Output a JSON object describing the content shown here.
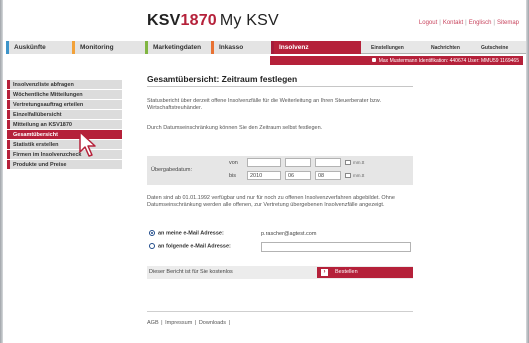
{
  "header": {
    "brand": "KSV",
    "year": "1870",
    "subtitle": "My KSV",
    "toplinks": [
      "Logout",
      "Kontakt",
      "Englisch",
      "Sitemap"
    ]
  },
  "nav": {
    "tabs": [
      "Auskünfte",
      "Monitoring",
      "Marketingdaten",
      "Inkasso",
      "Insolvenz"
    ],
    "subtabs": [
      "Einstellungen",
      "Nachrichten",
      "Gutscheine"
    ]
  },
  "userbar": {
    "text": "Max Mustermann Identifikation: 440674 User: MMU59 1169465"
  },
  "sidebar": {
    "items": [
      "Insolvenzliste abfragen",
      "Wöchentliche Mitteilungen",
      "Vertretungsauftrag erteilen",
      "Einzelfallübersicht",
      "Mitteilung an KSV1870",
      "Gesamtübersicht",
      "Statistik erstellen",
      "Firmen im Insolvenzcheck",
      "Produkte und Preise"
    ],
    "active_index": 5
  },
  "main": {
    "title": "Gesamtübersicht: Zeitraum festlegen",
    "intro": "Statusbericht über derzeit offene Insolvenzfälle für die Weiterleitung an Ihren Steuerberater bzw. Wirtschaftstreuhänder.",
    "hint": "Durch Datumseinschränkung können Sie den Zeitraum selbst festlegen.",
    "date": {
      "label": "Übergabedatum:",
      "from_label": "von",
      "to_label": "bis",
      "from": {
        "day": "",
        "month": "",
        "year": ""
      },
      "to": {
        "year": "2010",
        "month": "06",
        "day": "08"
      },
      "format": "mm.tt"
    },
    "notice": "Daten sind ab 01.01.1992 verfügbar und nur für noch zu offenen Insolvenzverfahren abgebildet. Ohne Datumseinschränkung werden alle offenen, zur Vertretung übergebenen Insolvenzfälle angezeigt.",
    "delivery": {
      "option1": "an meine e-Mail Adresse:",
      "option1_value": "p.rascher@agtest.com",
      "option2": "an folgende e-Mail Adresse:",
      "option2_value": ""
    },
    "cost": "Dieser Bericht ist für Sie kostenlos",
    "order_button": "Bestellen"
  },
  "footer": {
    "links": [
      "AGB",
      "Impressum",
      "Downloads"
    ]
  }
}
